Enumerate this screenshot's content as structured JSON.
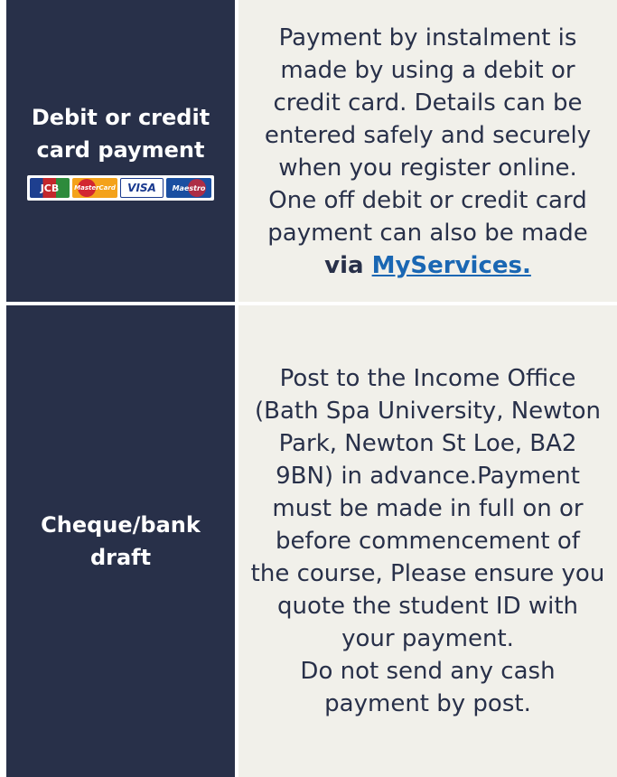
{
  "rows": [
    {
      "label": "Debit or credit\ncard payment",
      "card_logos": [
        "JCB",
        "MasterCard",
        "VISA",
        "Maestro"
      ],
      "text": "Payment by instalment is\nmade by using a debit or\ncredit card. Details can be\nentered safely and securely\nwhen you register online.\nOne off debit or credit card\npayment can also be made",
      "via_prefix": "via ",
      "via_link": "MyServices",
      "via_suffix": "."
    },
    {
      "label": "Cheque/bank\ndraft",
      "text": "Post to the Income Office\n(Bath Spa University, Newton\nPark, Newton St Loe, BA2\n9BN) in advance.Payment\nmust be made in full on or\nbefore commencement of\nthe course, Please ensure you\nquote the student ID with\nyour payment.\nDo not send any cash\npayment by post."
    }
  ],
  "colors": {
    "left_background": "#283049",
    "right_background": "#f1f0ea",
    "link": "#1a67b3"
  }
}
